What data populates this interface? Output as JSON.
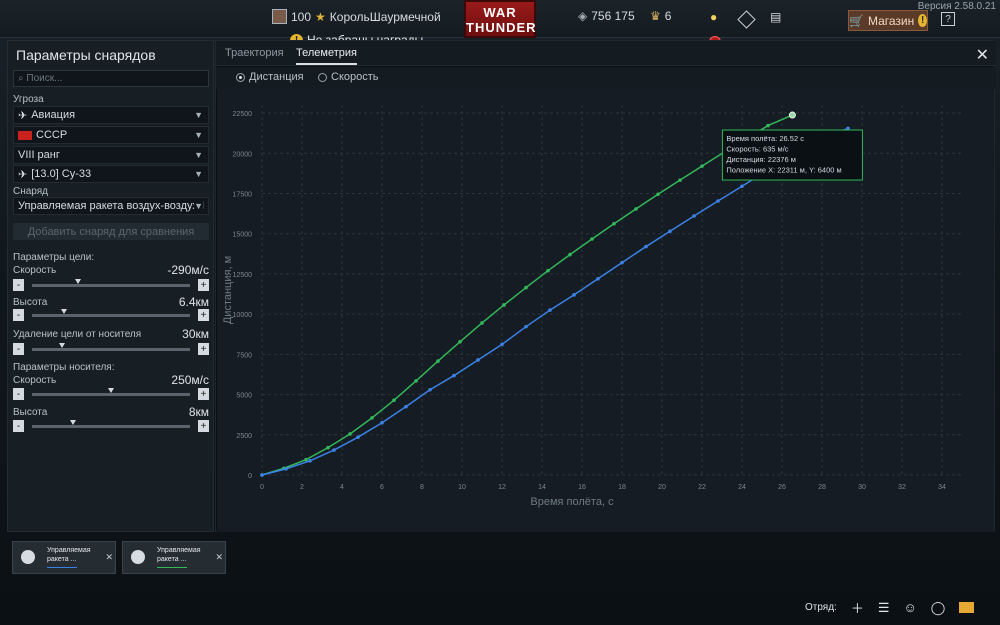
{
  "topbar": {
    "player_level": "100",
    "player_name": "КорольШаурмечной",
    "logo_line1": "WAR",
    "logo_line2": "THUNDER",
    "silver": "756 175",
    "gold": "6",
    "shop_label": "Магазин",
    "version": "Версия 2.58.0.21",
    "help_glyph": "?",
    "rewards_text": "Не забраны награды"
  },
  "left_panel": {
    "title": "Параметры снарядов",
    "search_placeholder": "Поиск...",
    "threat_label": "Угроза",
    "threat_type": "Авиация",
    "nation": "СССР",
    "rank": "VIII ранг",
    "vehicle": "[13.0] Су-33",
    "shell_label": "Снаряд",
    "shell": "Управляемая ракета воздух-воздух I",
    "compare_button": "Добавить снаряд для сравнения",
    "target_params_label": "Параметры цели:",
    "carrier_params_label": "Параметры носителя:",
    "params": [
      {
        "label": "Скорость",
        "value": "-290м/с",
        "level": 0.29
      },
      {
        "label": "Высота",
        "value": "6.4км",
        "level": 0.2
      },
      {
        "label": "Удаление цели от носителя",
        "value": "30км",
        "level": 0.19
      },
      {
        "label": "Скорость",
        "value": "250м/с",
        "level": 0.5
      },
      {
        "label": "Высота",
        "value": "8км",
        "level": 0.26
      }
    ]
  },
  "main": {
    "tabs": [
      "Траектория",
      "Телеметрия"
    ],
    "active_tab": "Телеметрия",
    "radio_distance": "Дистанция",
    "radio_speed": "Скорость",
    "tooltip": [
      "Время полёта: 26.52 с",
      "Скорость: 635 м/с",
      "Дистанция: 22376 м",
      "Положение X: 22311 м, Y: 6400 м"
    ]
  },
  "cards": [
    {
      "line1": "Управляемая",
      "line2": "ракета ...",
      "color": "#3b82e6"
    },
    {
      "line1": "Управляемая",
      "line2": "ракета ...",
      "color": "#33b75a"
    }
  ],
  "bottom": {
    "squad_label": "Отряд:"
  },
  "chart_data": {
    "type": "line",
    "title": "",
    "xlabel": "Время полёта, с",
    "ylabel": "Дистанция, м",
    "xlim": [
      0,
      35
    ],
    "ylim": [
      0,
      23000
    ],
    "xticks": [
      0,
      2,
      4,
      6,
      8,
      10,
      12,
      14,
      16,
      18,
      20,
      22,
      24,
      26,
      28,
      30,
      32,
      34
    ],
    "yticks": [
      0,
      2500,
      5000,
      7500,
      10000,
      12500,
      15000,
      17500,
      20000,
      22500
    ],
    "grid": true,
    "series": [
      {
        "color": "#33b75a",
        "x": [
          0,
          1.1,
          2.2,
          3.3,
          4.4,
          5.5,
          6.6,
          7.7,
          8.8,
          9.9,
          11,
          12.1,
          13.2,
          14.3,
          15.4,
          16.5,
          17.6,
          18.7,
          19.8,
          20.9,
          22,
          23.1,
          24.2,
          25.3,
          26.52
        ],
        "y": [
          0,
          420,
          950,
          1700,
          2550,
          3550,
          4650,
          5850,
          7080,
          8280,
          9450,
          10570,
          11650,
          12700,
          13700,
          14670,
          15620,
          16540,
          17450,
          18330,
          19200,
          20060,
          20900,
          21720,
          22376
        ]
      },
      {
        "color": "#3b82e6",
        "x": [
          0,
          1.2,
          2.4,
          3.6,
          4.8,
          6.0,
          7.2,
          8.4,
          9.6,
          10.8,
          12.0,
          13.2,
          14.4,
          15.6,
          16.8,
          18.0,
          19.2,
          20.4,
          21.6,
          22.8,
          24.0,
          25.2,
          26.4,
          27.6,
          28.8,
          29.3
        ],
        "y": [
          0,
          380,
          880,
          1550,
          2350,
          3250,
          4250,
          5300,
          6180,
          7150,
          8120,
          9220,
          10250,
          11200,
          12200,
          13200,
          14200,
          15150,
          16100,
          17030,
          17950,
          18880,
          19800,
          20720,
          21300,
          21550
        ]
      }
    ]
  }
}
